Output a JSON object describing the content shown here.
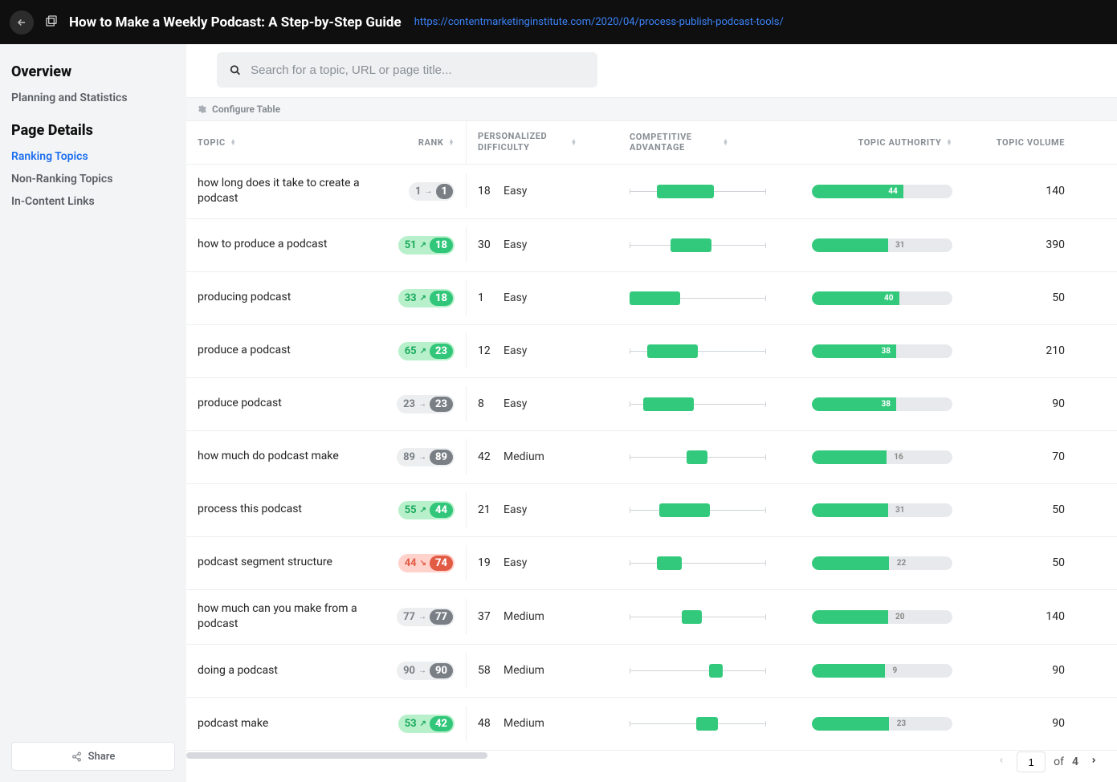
{
  "header": {
    "title": "How to Make a Weekly Podcast: A Step-by-Step Guide",
    "url": "https://contentmarketinginstitute.com/2020/04/process-publish-podcast-tools/"
  },
  "sidebar": {
    "heading1": "Overview",
    "planning": "Planning and Statistics",
    "heading2": "Page Details",
    "items": [
      {
        "label": "Ranking Topics",
        "active": true
      },
      {
        "label": "Non-Ranking Topics",
        "active": false
      },
      {
        "label": "In-Content Links",
        "active": false
      }
    ],
    "share": "Share"
  },
  "search": {
    "placeholder": "Search for a topic, URL or page title..."
  },
  "config": "Configure Table",
  "columns": {
    "topic": "TOPIC",
    "rank": "RANK",
    "pd": "PERSONALIZED DIFFICULTY",
    "ca": "COMPETITIVE ADVANTAGE",
    "ta": "TOPIC AUTHORITY",
    "tv": "TOPIC VOLUME"
  },
  "rows": [
    {
      "topic": "how long does it take to create a podcast",
      "rank_from": "1",
      "rank_to": "1",
      "rank_dir": "flat",
      "pd_num": "18",
      "pd_lab": "Easy",
      "ca_l": 20,
      "ca_w": 42,
      "ta": 44,
      "ta_pct": 65,
      "tv": "140"
    },
    {
      "topic": "how to produce a podcast",
      "rank_from": "51",
      "rank_to": "18",
      "rank_dir": "up",
      "pd_num": "30",
      "pd_lab": "Easy",
      "ca_l": 30,
      "ca_w": 30,
      "ta": 31,
      "ta_pct": 54,
      "tv": "390"
    },
    {
      "topic": "producing podcast",
      "rank_from": "33",
      "rank_to": "18",
      "rank_dir": "up",
      "pd_num": "1",
      "pd_lab": "Easy",
      "ca_l": 0,
      "ca_w": 37,
      "ta": 40,
      "ta_pct": 62,
      "tv": "50"
    },
    {
      "topic": "produce a podcast",
      "rank_from": "65",
      "rank_to": "23",
      "rank_dir": "up",
      "pd_num": "12",
      "pd_lab": "Easy",
      "ca_l": 13,
      "ca_w": 37,
      "ta": 38,
      "ta_pct": 60,
      "tv": "210"
    },
    {
      "topic": "produce podcast",
      "rank_from": "23",
      "rank_to": "23",
      "rank_dir": "flat",
      "pd_num": "8",
      "pd_lab": "Easy",
      "ca_l": 10,
      "ca_w": 37,
      "ta": 38,
      "ta_pct": 60,
      "tv": "90"
    },
    {
      "topic": "how much do podcast make",
      "rank_from": "89",
      "rank_to": "89",
      "rank_dir": "flat",
      "pd_num": "42",
      "pd_lab": "Medium",
      "ca_l": 42,
      "ca_w": 15,
      "ta": 16,
      "ta_pct": 53,
      "tv": "70"
    },
    {
      "topic": "process this podcast",
      "rank_from": "55",
      "rank_to": "44",
      "rank_dir": "up",
      "pd_num": "21",
      "pd_lab": "Easy",
      "ca_l": 22,
      "ca_w": 37,
      "ta": 31,
      "ta_pct": 54,
      "tv": "50"
    },
    {
      "topic": "podcast segment structure",
      "rank_from": "44",
      "rank_to": "74",
      "rank_dir": "down",
      "pd_num": "19",
      "pd_lab": "Easy",
      "ca_l": 20,
      "ca_w": 18,
      "ta": 22,
      "ta_pct": 55,
      "tv": "50"
    },
    {
      "topic": "how much can you make from a podcast",
      "rank_from": "77",
      "rank_to": "77",
      "rank_dir": "flat",
      "pd_num": "37",
      "pd_lab": "Medium",
      "ca_l": 38,
      "ca_w": 15,
      "ta": 20,
      "ta_pct": 54,
      "tv": "140"
    },
    {
      "topic": "doing a podcast",
      "rank_from": "90",
      "rank_to": "90",
      "rank_dir": "flat",
      "pd_num": "58",
      "pd_lab": "Medium",
      "ca_l": 58,
      "ca_w": 10,
      "ta": 9,
      "ta_pct": 52,
      "tv": "90"
    },
    {
      "topic": "podcast make",
      "rank_from": "53",
      "rank_to": "42",
      "rank_dir": "up",
      "pd_num": "48",
      "pd_lab": "Medium",
      "ca_l": 49,
      "ca_w": 16,
      "ta": 23,
      "ta_pct": 55,
      "tv": "90"
    }
  ],
  "pager": {
    "page": "1",
    "of": "of",
    "total": "4"
  }
}
